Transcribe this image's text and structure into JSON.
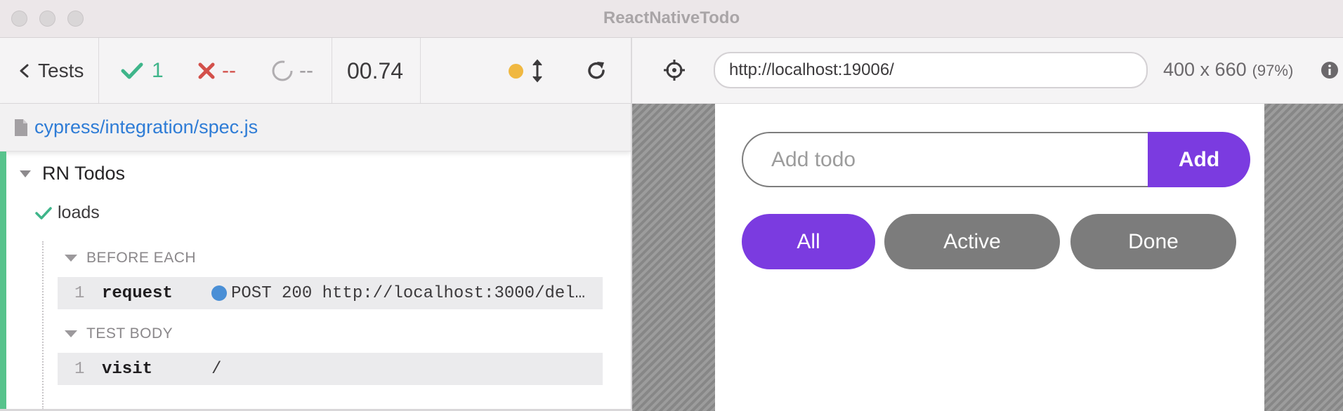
{
  "window": {
    "title": "ReactNativeTodo"
  },
  "reporter": {
    "tests_label": "Tests",
    "stats": {
      "passed": "1",
      "failed": "--",
      "pending": "--",
      "duration": "00.74"
    },
    "spec_file": "cypress/integration/spec.js",
    "suite": {
      "title": "RN Todos",
      "test": {
        "title": "loads",
        "hooks": [
          {
            "title": "BEFORE EACH",
            "commands": [
              {
                "number": "1",
                "name": "request",
                "message": "POST 200 http://localhost:3000/del…"
              }
            ]
          },
          {
            "title": "TEST BODY",
            "commands": [
              {
                "number": "1",
                "name": "visit",
                "message": "/"
              }
            ]
          }
        ]
      }
    }
  },
  "aut": {
    "url": "http://localhost:19006/",
    "viewport": "400 x 660",
    "viewport_pct": "(97%)",
    "app": {
      "input_placeholder": "Add todo",
      "add_label": "Add",
      "filters": [
        "All",
        "Active",
        "Done"
      ],
      "active_filter": "All"
    }
  },
  "colors": {
    "accent": "#7b3be0",
    "pass": "#3fb58a",
    "fail": "#d3504a",
    "link": "#2e7cd6",
    "status_running": "#f0b841"
  }
}
